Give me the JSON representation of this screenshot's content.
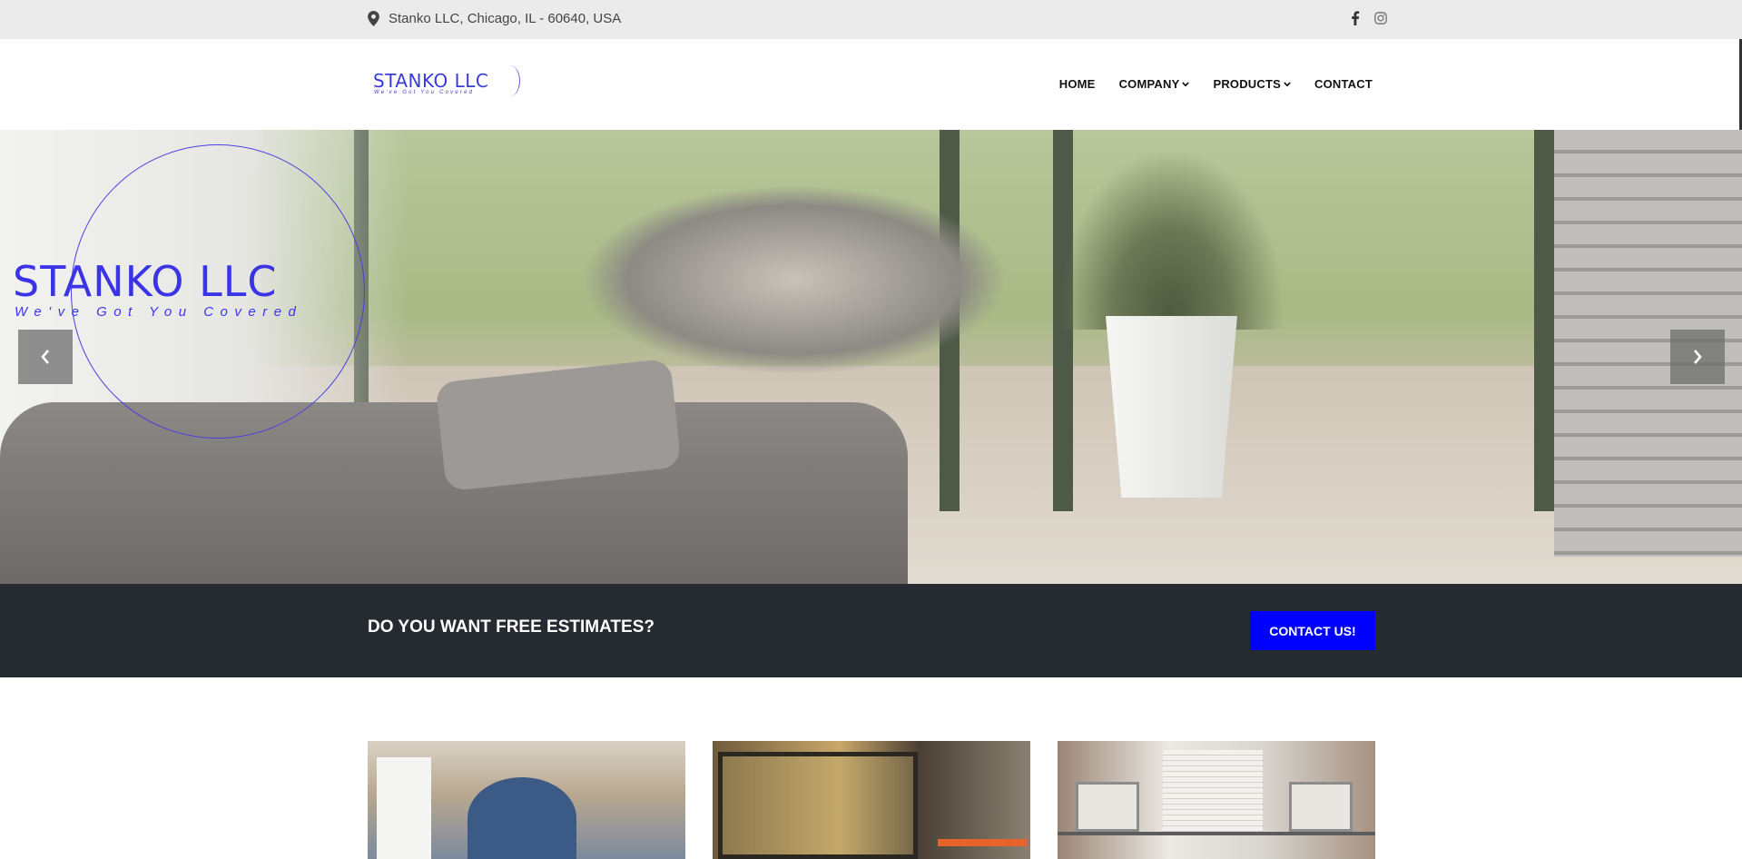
{
  "topbar": {
    "address": "Stanko LLC, Chicago, IL - 60640, USA",
    "address_icon": "map-pin-icon",
    "social": [
      "facebook-icon",
      "instagram-icon"
    ]
  },
  "header": {
    "logo_name": "STANKO LLC",
    "logo_tagline": "We've Got You Covered",
    "nav": [
      {
        "label": "HOME",
        "dropdown": false
      },
      {
        "label": "COMPANY",
        "dropdown": true
      },
      {
        "label": "PRODUCTS",
        "dropdown": true
      },
      {
        "label": "CONTACT",
        "dropdown": false
      }
    ]
  },
  "hero": {
    "title": "STANKO LLC",
    "tagline": "We've Got You Covered",
    "prev_icon": "chevron-left-icon",
    "next_icon": "chevron-right-icon"
  },
  "cta": {
    "text": "DO YOU WANT FREE ESTIMATES?",
    "button": "CONTACT US!"
  },
  "colors": {
    "accent": "#0000ff",
    "brand": "#3b34e6",
    "cta_background": "#262a31",
    "topbar_background": "#ebebeb"
  }
}
